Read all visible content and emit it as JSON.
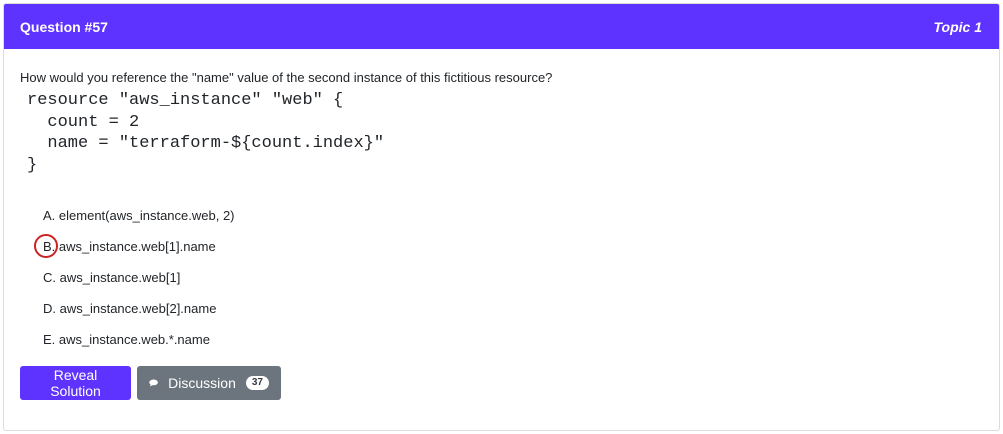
{
  "header": {
    "question_number": "Question #57",
    "topic": "Topic 1"
  },
  "question": {
    "text": "How would you reference the \"name\" value of the second instance of this fictitious resource?",
    "code": "resource \"aws_instance\" \"web\" {\n  count = 2\n  name = \"terraform-${count.index}\"\n}"
  },
  "choices": [
    {
      "letter": "A.",
      "text": "element(aws_instance.web, 2)"
    },
    {
      "letter": "B.",
      "text": "aws_instance.web[1].name",
      "marked": true
    },
    {
      "letter": "C.",
      "text": "aws_instance.web[1]"
    },
    {
      "letter": "D.",
      "text": "aws_instance.web[2].name"
    },
    {
      "letter": "E.",
      "text": "aws_instance.web.*.name"
    }
  ],
  "actions": {
    "reveal_label": "Reveal Solution",
    "discussion_label": "Discussion",
    "discussion_count": "37"
  },
  "colors": {
    "header_bg": "#5f33ff",
    "reveal_button_bg": "#5f33ff",
    "discussion_button_bg": "#6c757d",
    "mark_circle": "#cc2222"
  },
  "icons": {
    "discussion": "chat-bubble-icon"
  }
}
